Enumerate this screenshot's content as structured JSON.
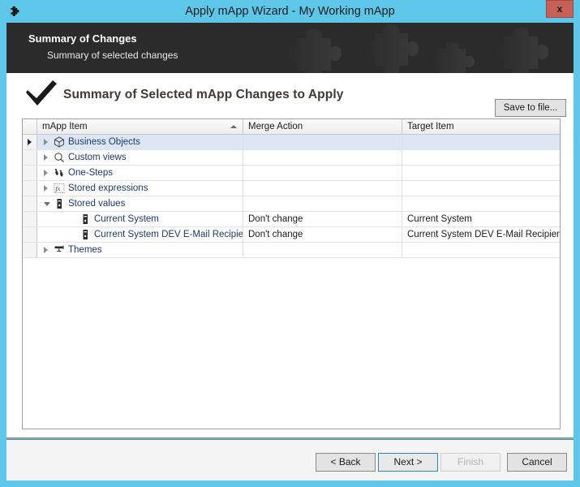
{
  "window": {
    "title": "Apply mApp Wizard - My Working mApp",
    "title_icon": "puzzle-piece-icon",
    "close_label": "x",
    "accent_color": "#5ec6e8"
  },
  "banner": {
    "title": "Summary of Changes",
    "subtitle": "Summary of selected changes",
    "background_color": "#2b2b2b"
  },
  "page": {
    "heading": "Summary of Selected mApp Changes to Apply",
    "heading_icon": "checkmark-icon",
    "save_button": "Save to file..."
  },
  "grid": {
    "columns": [
      {
        "label": "mApp Item",
        "sorted": "ascending"
      },
      {
        "label": "Merge Action",
        "sorted": "none"
      },
      {
        "label": "Target Item",
        "sorted": "none"
      }
    ],
    "rows": [
      {
        "level": 0,
        "icon": "cube-icon",
        "label": "Business Objects",
        "expander": "collapsed",
        "selected": true,
        "current_row": true,
        "merge_action": "",
        "target_item": ""
      },
      {
        "level": 0,
        "icon": "magnifier-icon",
        "label": "Custom views",
        "expander": "collapsed",
        "selected": false,
        "current_row": false,
        "merge_action": "",
        "target_item": ""
      },
      {
        "level": 0,
        "icon": "footsteps-icon",
        "label": "One-Steps",
        "expander": "collapsed",
        "selected": false,
        "current_row": false,
        "merge_action": "",
        "target_item": ""
      },
      {
        "level": 0,
        "icon": "fx-icon",
        "label": "Stored expressions",
        "expander": "collapsed",
        "selected": false,
        "current_row": false,
        "merge_action": "",
        "target_item": ""
      },
      {
        "level": 0,
        "icon": "stored-value-icon",
        "label": "Stored values",
        "expander": "expanded",
        "selected": false,
        "current_row": false,
        "merge_action": "",
        "target_item": ""
      },
      {
        "level": 1,
        "icon": "stored-value-icon",
        "label": "Current System",
        "expander": "none",
        "selected": false,
        "current_row": false,
        "merge_action": "Don't change",
        "target_item": "Current System"
      },
      {
        "level": 1,
        "icon": "stored-value-icon",
        "label": "Current System DEV E-Mail Recipient",
        "expander": "none",
        "selected": false,
        "current_row": false,
        "merge_action": "Don't change",
        "target_item": "Current System DEV E-Mail Recipient"
      },
      {
        "level": 0,
        "icon": "paint-roller-icon",
        "label": "Themes",
        "expander": "collapsed",
        "selected": false,
        "current_row": false,
        "merge_action": "",
        "target_item": ""
      }
    ]
  },
  "footer": {
    "back": "< Back",
    "next": "Next >",
    "finish": "Finish",
    "cancel": "Cancel",
    "finish_disabled": true,
    "next_is_default": true
  }
}
